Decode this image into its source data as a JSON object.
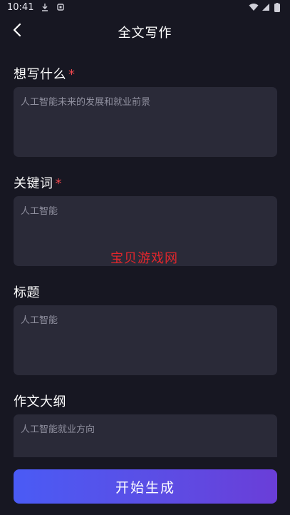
{
  "status_bar": {
    "time": "10:41"
  },
  "header": {
    "title": "全文写作"
  },
  "fields": [
    {
      "label": "想写什么",
      "required": true,
      "value": "人工智能未来的发展和就业前景"
    },
    {
      "label": "关键词",
      "required": true,
      "value": "人工智能"
    },
    {
      "label": "标题",
      "required": false,
      "value": "人工智能"
    },
    {
      "label": "作文大纲",
      "required": false,
      "value": "人工智能就业方向"
    }
  ],
  "required_mark": "*",
  "watermark": "宝贝游戏网",
  "actions": {
    "generate_label": "开始生成"
  },
  "colors": {
    "background": "#171722",
    "field_background": "#2a2a38",
    "required": "#f0484e",
    "button_gradient_start": "#4a5bf5",
    "button_gradient_end": "#6a3ed8"
  }
}
